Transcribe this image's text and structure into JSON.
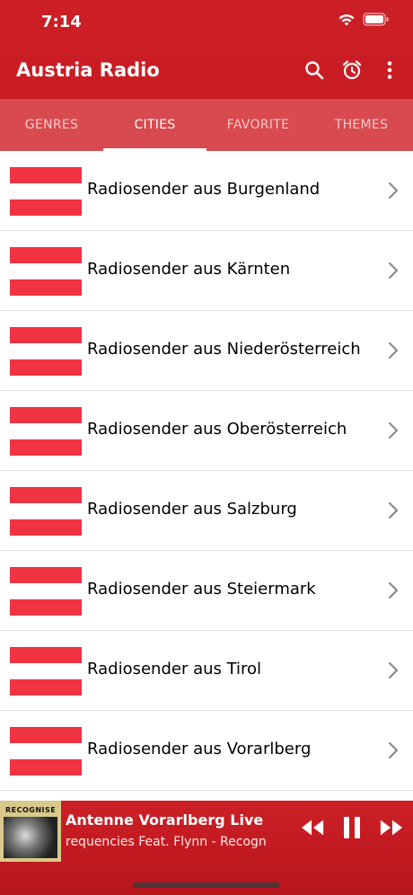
{
  "status": {
    "time": "7:14"
  },
  "appbar": {
    "title": "Austria Radio"
  },
  "tabs": [
    {
      "label": "GENRES",
      "active": false
    },
    {
      "label": "CITIES",
      "active": true
    },
    {
      "label": "FAVORITE",
      "active": false
    },
    {
      "label": "THEMES",
      "active": false
    }
  ],
  "list": [
    {
      "label": "Radiosender aus Burgenland"
    },
    {
      "label": "Radiosender aus Kärnten"
    },
    {
      "label": "Radiosender aus Niederösterreich"
    },
    {
      "label": "Radiosender aus Oberösterreich"
    },
    {
      "label": "Radiosender aus Salzburg"
    },
    {
      "label": "Radiosender aus Steiermark"
    },
    {
      "label": "Radiosender aus Tirol"
    },
    {
      "label": "Radiosender aus Vorarlberg"
    }
  ],
  "player": {
    "cover_text": "RECOGNISE",
    "title": "Antenne Vorarlberg Live",
    "subtitle": "requencies Feat. Flynn - Recogn"
  },
  "colors": {
    "brand_red": "#cc1f26",
    "tab_bg": "#d84a4f",
    "flag_red": "#ef3340"
  }
}
